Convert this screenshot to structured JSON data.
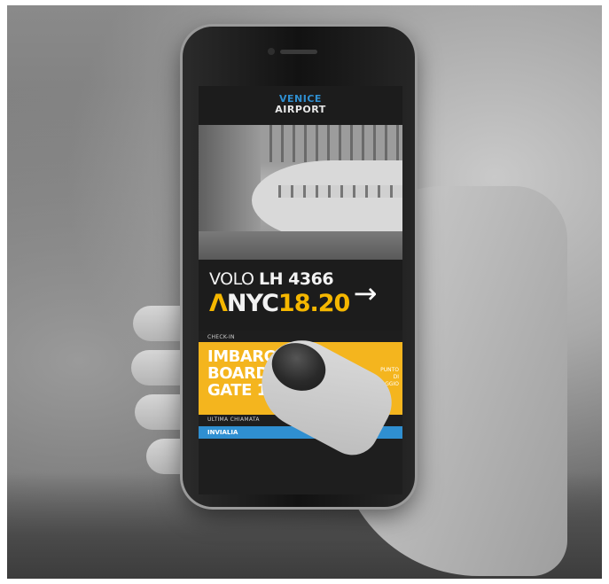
{
  "app": {
    "brand_line1": "VENICE",
    "brand_line2": "AIRPORT"
  },
  "flight": {
    "prefix": "VOLO ",
    "number": "LH 4366",
    "caret": "Λ",
    "destination": "NYC",
    "time": "18.20",
    "arrow_icon": "arrow-right-icon"
  },
  "checkin": {
    "label": "CHECK-IN"
  },
  "boarding": {
    "line1": "IMBARCO",
    "line2": "BOARDING",
    "gate_label": "GATE ",
    "gate_number": "12",
    "side_text_1": "PUNTO",
    "side_text_2": "DI PASSAGGIO"
  },
  "last_call": {
    "label": "ULTIMA CHIAMATA",
    "status": "INVIALIA"
  },
  "colors": {
    "accent_yellow": "#f4b51e",
    "accent_blue": "#2f8fd1",
    "screen_bg": "#1c1c1c"
  }
}
